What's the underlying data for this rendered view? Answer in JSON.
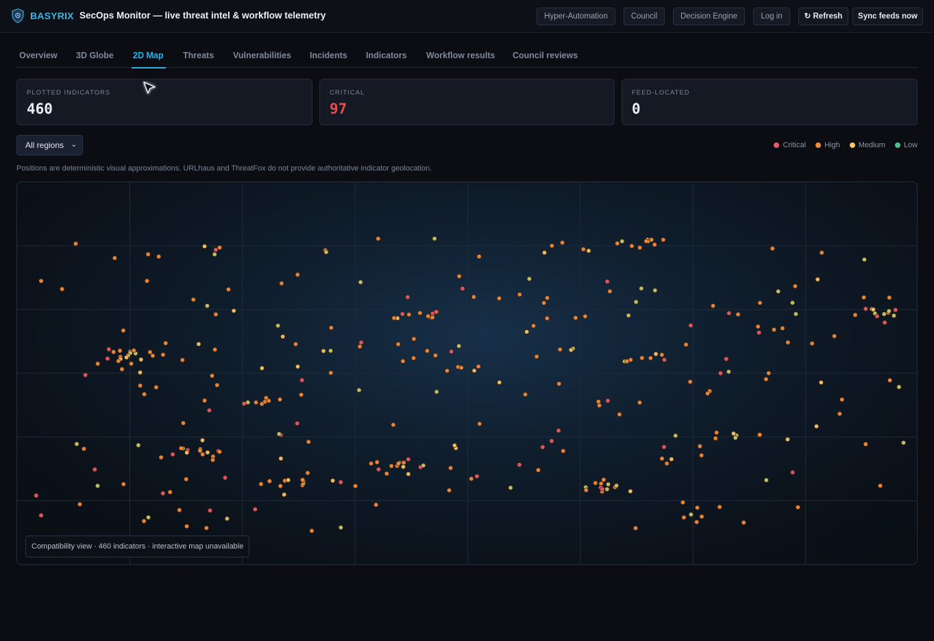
{
  "header": {
    "brand": "BASYRIX",
    "title": "SecOps Monitor — live threat intel & workflow telemetry",
    "buttons": {
      "hyper_automation": "Hyper-Automation",
      "council": "Council",
      "decision_engine": "Decision Engine",
      "login": "Log in",
      "refresh": "↻ Refresh",
      "sync": "Sync feeds now"
    }
  },
  "tabs": [
    {
      "label": "Overview",
      "active": false
    },
    {
      "label": "3D Globe",
      "active": false
    },
    {
      "label": "2D Map",
      "active": true
    },
    {
      "label": "Threats",
      "active": false
    },
    {
      "label": "Vulnerabilities",
      "active": false
    },
    {
      "label": "Incidents",
      "active": false
    },
    {
      "label": "Indicators",
      "active": false
    },
    {
      "label": "Workflow results",
      "active": false
    },
    {
      "label": "Council reviews",
      "active": false
    }
  ],
  "stats": {
    "plotted": {
      "label": "Plotted indicators",
      "value": "460"
    },
    "critical": {
      "label": "Critical",
      "value": "97"
    },
    "feed_located": {
      "label": "Feed-located",
      "value": "0"
    }
  },
  "filters": {
    "region_selected": "All regions"
  },
  "legend": [
    {
      "label": "Critical",
      "color": "#e85a6a"
    },
    {
      "label": "High",
      "color": "#f28a3c"
    },
    {
      "label": "Medium",
      "color": "#f2c66d"
    },
    {
      "label": "Low",
      "color": "#48c48a"
    }
  ],
  "note": "Positions are deterministic visual approximations. URLhaus and ThreatFox do not provide authoritative indicator geolocation.",
  "map": {
    "caption": "Compatibility view · 460 indicators · interactive map unavailable"
  },
  "colors": {
    "accent": "#2fb3e6",
    "critical": "#ef4a4a",
    "high": "#f28a3c",
    "medium": "#f2c66d",
    "low": "#48c48a"
  }
}
